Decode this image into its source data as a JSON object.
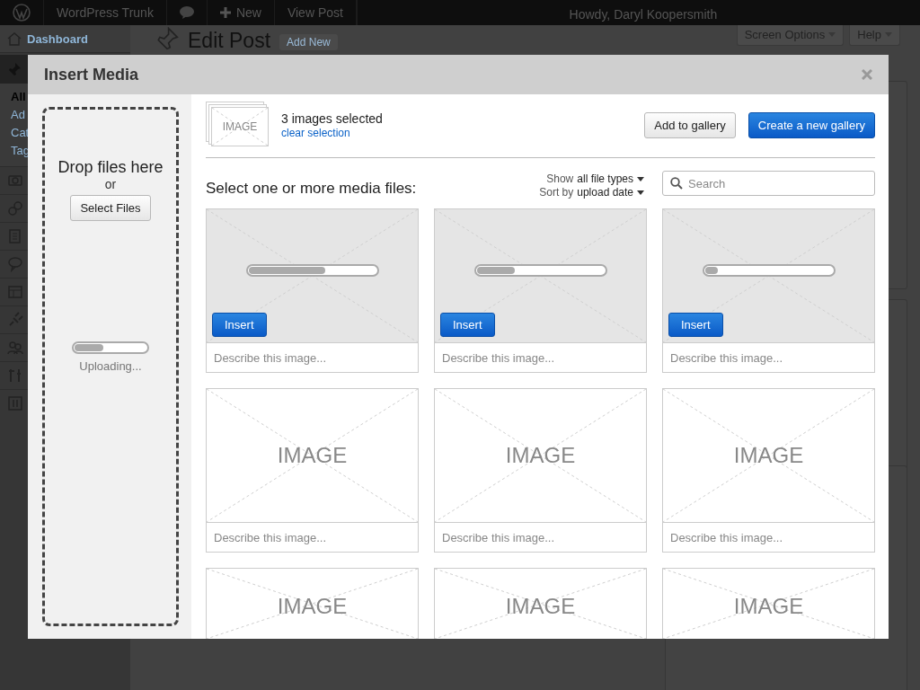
{
  "admin_bar": {
    "site_name": "WordPress Trunk",
    "new_label": "New",
    "view_label": "View Post",
    "greeting": "Howdy, Daryl Koopersmith"
  },
  "screen_meta": {
    "screen_options": "Screen Options",
    "help": "Help"
  },
  "admin_menu": {
    "dashboard": "Dashboard",
    "submenu": [
      {
        "label": "All",
        "selected": true
      },
      {
        "label": "Ad",
        "selected": false
      },
      {
        "label": "Cat",
        "selected": false
      },
      {
        "label": "Tag",
        "selected": false
      }
    ]
  },
  "page": {
    "title": "Edit Post",
    "add_new": "Add New"
  },
  "modal": {
    "title": "Insert Media",
    "uploader": {
      "drop_text": "Drop files here",
      "or_text": "or",
      "button": "Select Files",
      "level": 0.4,
      "status": "Uploading..."
    },
    "selection": {
      "thumb_label": "IMAGE",
      "count": "3 images selected",
      "clear_link": "clear selection"
    },
    "actions": [
      {
        "label": "Add to gallery",
        "kind": "secondary"
      },
      {
        "label": "Create a new gallery",
        "kind": "primary"
      }
    ],
    "heading": "Select one or more media files:",
    "filters": [
      {
        "label": "Show",
        "value": "all file types"
      },
      {
        "label": "Sort by",
        "value": "upload date"
      }
    ],
    "search": {
      "placeholder": "Search"
    },
    "tiles": [
      {
        "kind": "uploading",
        "level": 0.6,
        "button": "Insert",
        "caption_placeholder": "Describe this image..."
      },
      {
        "kind": "uploading",
        "level": 0.3,
        "button": "Insert",
        "caption_placeholder": "Describe this image..."
      },
      {
        "kind": "uploading",
        "level": 0.1,
        "button": "Insert",
        "caption_placeholder": "Describe this image..."
      },
      {
        "kind": "image",
        "label": "IMAGE",
        "caption_placeholder": "Describe this image..."
      },
      {
        "kind": "image",
        "label": "IMAGE",
        "caption_placeholder": "Describe this image..."
      },
      {
        "kind": "image",
        "label": "IMAGE",
        "caption_placeholder": "Describe this image..."
      },
      {
        "kind": "image",
        "label": "IMAGE"
      },
      {
        "kind": "image",
        "label": "IMAGE"
      },
      {
        "kind": "image",
        "label": "IMAGE"
      }
    ]
  }
}
